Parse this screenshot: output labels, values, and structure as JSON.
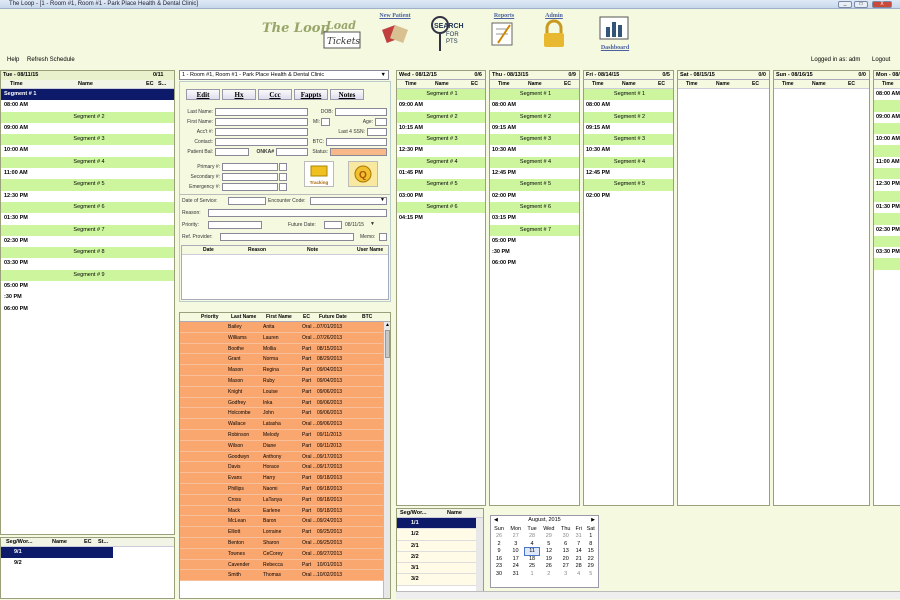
{
  "window": {
    "title": "The Loop - [1 - Room #1, Room #1 - Park Place Health & Dental Clinic]",
    "min": "_",
    "max": "□",
    "close": "X"
  },
  "toolbar": {
    "logo": "The Loop",
    "load_tickets": "Load Tickets",
    "new_patient": "New Patient",
    "search_pts": "SEARCH FOR PTS",
    "reports": "Reports",
    "admin": "Admin",
    "dashboard": "Dashboard"
  },
  "menu": {
    "help": "Help",
    "refresh": "Refresh Schedule",
    "logged_in": "Logged in as: adm",
    "logout": "Logout"
  },
  "left": {
    "day": "Tue - 08/11/15",
    "count": "0/11",
    "cols": [
      "Time",
      "Name",
      "EC",
      "S..."
    ],
    "rows": [
      {
        "t": "Segment # 1",
        "k": "segsel"
      },
      {
        "t": "08:00 AM",
        "k": "slot"
      },
      {
        "t": "Segment # 2",
        "k": "seg"
      },
      {
        "t": "09:00 AM",
        "k": "slot"
      },
      {
        "t": "Segment # 3",
        "k": "seg"
      },
      {
        "t": "10:00 AM",
        "k": "slot"
      },
      {
        "t": "Segment # 4",
        "k": "seg"
      },
      {
        "t": "11:00 AM",
        "k": "slot"
      },
      {
        "t": "Segment # 5",
        "k": "seg"
      },
      {
        "t": "12:30 PM",
        "k": "slot"
      },
      {
        "t": "Segment # 6",
        "k": "seg"
      },
      {
        "t": "01:30 PM",
        "k": "slot"
      },
      {
        "t": "Segment # 7",
        "k": "seg"
      },
      {
        "t": "02:30 PM",
        "k": "slot"
      },
      {
        "t": "Segment # 8",
        "k": "seg"
      },
      {
        "t": "03:30 PM",
        "k": "slot"
      },
      {
        "t": "Segment # 9",
        "k": "seg"
      },
      {
        "t": "05:00 PM",
        "k": "slot"
      },
      {
        "t": ":30 PM",
        "k": "slot"
      },
      {
        "t": "06:00 PM",
        "k": "slot"
      }
    ]
  },
  "segwork_left": {
    "cols": [
      "Seg/Wor...",
      "Name",
      "EC",
      "St..."
    ],
    "rows": [
      "9/1",
      "9/2"
    ]
  },
  "form": {
    "room": "1 - Room #1, Room #1 - Park Place Health & Dental Clinic",
    "buttons": [
      "Edit",
      "Hx",
      "Ccc",
      "Fappts",
      "Notes"
    ],
    "last_name": "Last Name:",
    "dob": "DOB:",
    "first_name": "First Name:",
    "mi": "MI:",
    "age": "Age:",
    "acct": "Acc't #:",
    "ssn": "Last 4 SSN:",
    "contact": "Contact:",
    "btc": "BTC:",
    "pat_bal": "Patient Bal:",
    "onka": "ONKA#",
    "status": "Status:",
    "primary": "Primary #:",
    "secondary": "Secondary #:",
    "emergency": "Emergency #:",
    "tracking": "Tracking",
    "dos": "Date of Service:",
    "enc": "Encounter Code:",
    "reason": "Reason:",
    "priority": "Priority:",
    "future": "Future Date:",
    "future_val": "08/11/15",
    "ref": "Ref. Provider:",
    "memo": "Memo:",
    "note_cols": [
      "Date",
      "Reason",
      "Note",
      "User Name"
    ]
  },
  "patients": {
    "cols": [
      "Priority",
      "Last Name",
      "First Name",
      "EC",
      "Future Date",
      "BTC"
    ],
    "rows": [
      [
        "Bailey",
        "Anita",
        "Oral ...",
        "07/01/2013"
      ],
      [
        "Williams",
        "Lauren",
        "Oral ...",
        "07/26/2013"
      ],
      [
        "Boothe",
        "Mollia",
        "Part",
        "08/15/2013"
      ],
      [
        "Grant",
        "Norma",
        "Part",
        "08/29/2013"
      ],
      [
        "Mason",
        "Regina",
        "Part",
        "09/04/2013"
      ],
      [
        "Mason",
        "Ruby",
        "Part",
        "09/04/2013"
      ],
      [
        "Knight",
        "Louise",
        "Part",
        "09/06/2013"
      ],
      [
        "Godfrey",
        "Inka",
        "Part",
        "09/06/2013"
      ],
      [
        "Holcombe",
        "John",
        "Part",
        "09/06/2013"
      ],
      [
        "Wallace",
        "Latasha",
        "Oral ...",
        "09/06/2013"
      ],
      [
        "Robinson",
        "Melody",
        "Part",
        "09/11/2013"
      ],
      [
        "Wilson",
        "Diane",
        "Part",
        "09/11/2013"
      ],
      [
        "Goodwyn",
        "Anthony",
        "Oral ...",
        "09/17/2013"
      ],
      [
        "Davis",
        "Horace",
        "Oral ...",
        "09/17/2013"
      ],
      [
        "Evans",
        "Harry",
        "Part",
        "09/18/2013"
      ],
      [
        "Phillips",
        "Naomi",
        "Part",
        "09/18/2013"
      ],
      [
        "Cross",
        "LaTanya",
        "Part",
        "09/18/2013"
      ],
      [
        "Mack",
        "Earlene",
        "Part",
        "09/18/2013"
      ],
      [
        "McLean",
        "Baron",
        "Oral ...",
        "09/24/2013"
      ],
      [
        "Elliott",
        "Lorraine",
        "Part",
        "09/25/2013"
      ],
      [
        "Benton",
        "Sharon",
        "Oral ...",
        "09/25/2013"
      ],
      [
        "Townes",
        "CeCorey",
        "Oral ...",
        "09/27/2013"
      ],
      [
        "Cavender",
        "Rebecca",
        "Part",
        "10/01/2013"
      ],
      [
        "Smith",
        "Thomas",
        "Oral ...",
        "10/02/2013"
      ]
    ]
  },
  "days": [
    {
      "day": "Wed - 08/12/15",
      "count": "0/6",
      "cols": [
        "Time",
        "Name",
        "EC"
      ],
      "rows": [
        {
          "t": "Segment # 1",
          "k": "seg"
        },
        {
          "t": "09:00 AM",
          "k": "slot"
        },
        {
          "t": "Segment # 2",
          "k": "seg"
        },
        {
          "t": "10:15 AM",
          "k": "slot"
        },
        {
          "t": "Segment # 3",
          "k": "seg"
        },
        {
          "t": "12:30 PM",
          "k": "slot"
        },
        {
          "t": "Segment # 4",
          "k": "seg"
        },
        {
          "t": "01:45 PM",
          "k": "slot"
        },
        {
          "t": "Segment # 5",
          "k": "seg"
        },
        {
          "t": "03:00 PM",
          "k": "slot"
        },
        {
          "t": "Segment # 6",
          "k": "seg"
        },
        {
          "t": "04:15 PM",
          "k": "slot"
        }
      ]
    },
    {
      "day": "Thu - 08/13/15",
      "count": "0/9",
      "cols": [
        "Time",
        "Name",
        "EC"
      ],
      "rows": [
        {
          "t": "Segment # 1",
          "k": "seg"
        },
        {
          "t": "08:00 AM",
          "k": "slot"
        },
        {
          "t": "Segment # 2",
          "k": "seg"
        },
        {
          "t": "09:15 AM",
          "k": "slot"
        },
        {
          "t": "Segment # 3",
          "k": "seg"
        },
        {
          "t": "10:30 AM",
          "k": "slot"
        },
        {
          "t": "Segment # 4",
          "k": "seg"
        },
        {
          "t": "12:45 PM",
          "k": "slot"
        },
        {
          "t": "Segment # 5",
          "k": "seg"
        },
        {
          "t": "02:00 PM",
          "k": "slot"
        },
        {
          "t": "Segment # 6",
          "k": "seg"
        },
        {
          "t": "03:15 PM",
          "k": "slot"
        },
        {
          "t": "Segment # 7",
          "k": "seg"
        },
        {
          "t": "05:00 PM",
          "k": "slot"
        },
        {
          "t": ":30 PM",
          "k": "slot"
        },
        {
          "t": "06:00 PM",
          "k": "slot"
        }
      ]
    },
    {
      "day": "Fri - 08/14/15",
      "count": "0/5",
      "cols": [
        "Time",
        "Name",
        "EC"
      ],
      "rows": [
        {
          "t": "Segment # 1",
          "k": "seg"
        },
        {
          "t": "08:00 AM",
          "k": "slot"
        },
        {
          "t": "Segment # 2",
          "k": "seg"
        },
        {
          "t": "09:15 AM",
          "k": "slot"
        },
        {
          "t": "Segment # 3",
          "k": "seg"
        },
        {
          "t": "10:30 AM",
          "k": "slot"
        },
        {
          "t": "Segment # 4",
          "k": "seg"
        },
        {
          "t": "12:45 PM",
          "k": "slot"
        },
        {
          "t": "Segment # 5",
          "k": "seg"
        },
        {
          "t": "02:00 PM",
          "k": "slot"
        }
      ]
    },
    {
      "day": "Sat - 08/15/15",
      "count": "0/0",
      "cols": [
        "Time",
        "Name",
        "EC"
      ],
      "rows": []
    },
    {
      "day": "Sun - 08/16/15",
      "count": "0/0",
      "cols": [
        "Time",
        "Name",
        "EC"
      ],
      "rows": []
    },
    {
      "day": "Mon - 08/",
      "count": "",
      "cols": [
        "Time",
        "Name"
      ],
      "rows": [
        {
          "t": "08:00 AM",
          "k": "slot"
        },
        {
          "t": "",
          "k": "seg"
        },
        {
          "t": "09:00 AM",
          "k": "slot"
        },
        {
          "t": "",
          "k": "seg"
        },
        {
          "t": "10:00 AM",
          "k": "slot"
        },
        {
          "t": "",
          "k": "seg"
        },
        {
          "t": "11:00 AM",
          "k": "slot"
        },
        {
          "t": "",
          "k": "seg"
        },
        {
          "t": "12:30 PM",
          "k": "slot"
        },
        {
          "t": "",
          "k": "seg"
        },
        {
          "t": "01:30 PM",
          "k": "slot"
        },
        {
          "t": "",
          "k": "seg"
        },
        {
          "t": "02:30 PM",
          "k": "slot"
        },
        {
          "t": "",
          "k": "seg"
        },
        {
          "t": "03:30 PM",
          "k": "slot"
        },
        {
          "t": "",
          "k": "seg"
        }
      ]
    }
  ],
  "segwork_mid": {
    "cols": [
      "Seg/Wor...",
      "Name"
    ],
    "rows": [
      "1/1",
      "1/2",
      "2/1",
      "2/2",
      "3/1",
      "3/2"
    ]
  },
  "calendar": {
    "title": "August, 2015",
    "prev": "◀",
    "next": "▶",
    "dow": [
      "Sun",
      "Mon",
      "Tue",
      "Wed",
      "Thu",
      "Fri",
      "Sat"
    ],
    "weeks": [
      [
        "26",
        "27",
        "28",
        "29",
        "30",
        "31",
        "1"
      ],
      [
        "2",
        "3",
        "4",
        "5",
        "6",
        "7",
        "8"
      ],
      [
        "9",
        "10",
        "11",
        "12",
        "13",
        "14",
        "15"
      ],
      [
        "16",
        "17",
        "18",
        "19",
        "20",
        "21",
        "22"
      ],
      [
        "23",
        "24",
        "25",
        "26",
        "27",
        "28",
        "29"
      ],
      [
        "30",
        "31",
        "1",
        "2",
        "3",
        "4",
        "5"
      ]
    ]
  },
  "colors": {
    "segment": "#ccf59e",
    "selected": "#0d1a6a",
    "patient_row": "#f9a66f",
    "background": "#f4f9e0"
  }
}
